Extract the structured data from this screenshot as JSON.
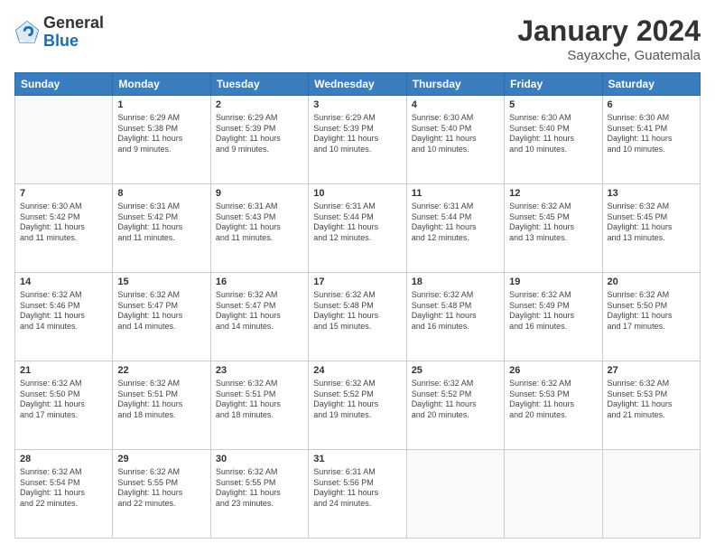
{
  "logo": {
    "general": "General",
    "blue": "Blue"
  },
  "header": {
    "month": "January 2024",
    "location": "Sayaxche, Guatemala"
  },
  "days_header": [
    "Sunday",
    "Monday",
    "Tuesday",
    "Wednesday",
    "Thursday",
    "Friday",
    "Saturday"
  ],
  "weeks": [
    [
      {
        "day": "",
        "info": ""
      },
      {
        "day": "1",
        "info": "Sunrise: 6:29 AM\nSunset: 5:38 PM\nDaylight: 11 hours\nand 9 minutes."
      },
      {
        "day": "2",
        "info": "Sunrise: 6:29 AM\nSunset: 5:39 PM\nDaylight: 11 hours\nand 9 minutes."
      },
      {
        "day": "3",
        "info": "Sunrise: 6:29 AM\nSunset: 5:39 PM\nDaylight: 11 hours\nand 10 minutes."
      },
      {
        "day": "4",
        "info": "Sunrise: 6:30 AM\nSunset: 5:40 PM\nDaylight: 11 hours\nand 10 minutes."
      },
      {
        "day": "5",
        "info": "Sunrise: 6:30 AM\nSunset: 5:40 PM\nDaylight: 11 hours\nand 10 minutes."
      },
      {
        "day": "6",
        "info": "Sunrise: 6:30 AM\nSunset: 5:41 PM\nDaylight: 11 hours\nand 10 minutes."
      }
    ],
    [
      {
        "day": "7",
        "info": "Sunrise: 6:30 AM\nSunset: 5:42 PM\nDaylight: 11 hours\nand 11 minutes."
      },
      {
        "day": "8",
        "info": "Sunrise: 6:31 AM\nSunset: 5:42 PM\nDaylight: 11 hours\nand 11 minutes."
      },
      {
        "day": "9",
        "info": "Sunrise: 6:31 AM\nSunset: 5:43 PM\nDaylight: 11 hours\nand 11 minutes."
      },
      {
        "day": "10",
        "info": "Sunrise: 6:31 AM\nSunset: 5:44 PM\nDaylight: 11 hours\nand 12 minutes."
      },
      {
        "day": "11",
        "info": "Sunrise: 6:31 AM\nSunset: 5:44 PM\nDaylight: 11 hours\nand 12 minutes."
      },
      {
        "day": "12",
        "info": "Sunrise: 6:32 AM\nSunset: 5:45 PM\nDaylight: 11 hours\nand 13 minutes."
      },
      {
        "day": "13",
        "info": "Sunrise: 6:32 AM\nSunset: 5:45 PM\nDaylight: 11 hours\nand 13 minutes."
      }
    ],
    [
      {
        "day": "14",
        "info": "Sunrise: 6:32 AM\nSunset: 5:46 PM\nDaylight: 11 hours\nand 14 minutes."
      },
      {
        "day": "15",
        "info": "Sunrise: 6:32 AM\nSunset: 5:47 PM\nDaylight: 11 hours\nand 14 minutes."
      },
      {
        "day": "16",
        "info": "Sunrise: 6:32 AM\nSunset: 5:47 PM\nDaylight: 11 hours\nand 14 minutes."
      },
      {
        "day": "17",
        "info": "Sunrise: 6:32 AM\nSunset: 5:48 PM\nDaylight: 11 hours\nand 15 minutes."
      },
      {
        "day": "18",
        "info": "Sunrise: 6:32 AM\nSunset: 5:48 PM\nDaylight: 11 hours\nand 16 minutes."
      },
      {
        "day": "19",
        "info": "Sunrise: 6:32 AM\nSunset: 5:49 PM\nDaylight: 11 hours\nand 16 minutes."
      },
      {
        "day": "20",
        "info": "Sunrise: 6:32 AM\nSunset: 5:50 PM\nDaylight: 11 hours\nand 17 minutes."
      }
    ],
    [
      {
        "day": "21",
        "info": "Sunrise: 6:32 AM\nSunset: 5:50 PM\nDaylight: 11 hours\nand 17 minutes."
      },
      {
        "day": "22",
        "info": "Sunrise: 6:32 AM\nSunset: 5:51 PM\nDaylight: 11 hours\nand 18 minutes."
      },
      {
        "day": "23",
        "info": "Sunrise: 6:32 AM\nSunset: 5:51 PM\nDaylight: 11 hours\nand 18 minutes."
      },
      {
        "day": "24",
        "info": "Sunrise: 6:32 AM\nSunset: 5:52 PM\nDaylight: 11 hours\nand 19 minutes."
      },
      {
        "day": "25",
        "info": "Sunrise: 6:32 AM\nSunset: 5:52 PM\nDaylight: 11 hours\nand 20 minutes."
      },
      {
        "day": "26",
        "info": "Sunrise: 6:32 AM\nSunset: 5:53 PM\nDaylight: 11 hours\nand 20 minutes."
      },
      {
        "day": "27",
        "info": "Sunrise: 6:32 AM\nSunset: 5:53 PM\nDaylight: 11 hours\nand 21 minutes."
      }
    ],
    [
      {
        "day": "28",
        "info": "Sunrise: 6:32 AM\nSunset: 5:54 PM\nDaylight: 11 hours\nand 22 minutes."
      },
      {
        "day": "29",
        "info": "Sunrise: 6:32 AM\nSunset: 5:55 PM\nDaylight: 11 hours\nand 22 minutes."
      },
      {
        "day": "30",
        "info": "Sunrise: 6:32 AM\nSunset: 5:55 PM\nDaylight: 11 hours\nand 23 minutes."
      },
      {
        "day": "31",
        "info": "Sunrise: 6:31 AM\nSunset: 5:56 PM\nDaylight: 11 hours\nand 24 minutes."
      },
      {
        "day": "",
        "info": ""
      },
      {
        "day": "",
        "info": ""
      },
      {
        "day": "",
        "info": ""
      }
    ]
  ]
}
